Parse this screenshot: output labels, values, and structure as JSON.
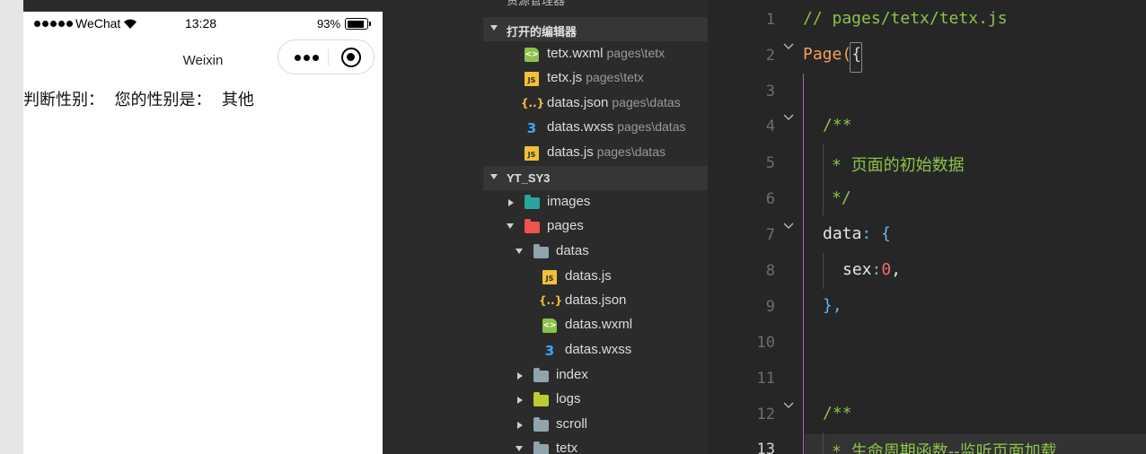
{
  "simulator": {
    "status_bar": {
      "carrier": "WeChat",
      "time": "13:28",
      "battery": "93%"
    },
    "nav_title": "Weixin",
    "page_text": "判断性别：  您的性别是：  其他"
  },
  "explorer": {
    "top_label": "资源管理器",
    "open_editors": {
      "title": "打开的编辑器",
      "items": [
        {
          "name": "tetx.wxml",
          "path": "pages\\tetx",
          "icon": "wxml-file-icon"
        },
        {
          "name": "tetx.js",
          "path": "pages\\tetx",
          "icon": "js-file-icon"
        },
        {
          "name": "datas.json",
          "path": "pages\\datas",
          "icon": "json-file-icon"
        },
        {
          "name": "datas.wxss",
          "path": "pages\\datas",
          "icon": "wxss-file-icon"
        },
        {
          "name": "datas.js",
          "path": "pages\\datas",
          "icon": "js-file-icon"
        }
      ]
    },
    "project": {
      "title": "YT_SY3",
      "tree": [
        {
          "name": "images",
          "type": "folder",
          "expanded": false,
          "color": "#26a69a"
        },
        {
          "name": "pages",
          "type": "folder",
          "expanded": true,
          "color": "#ef5350"
        },
        {
          "name": "datas",
          "type": "folder",
          "expanded": true,
          "color": "#90a4ae"
        },
        {
          "name": "datas.js",
          "type": "js"
        },
        {
          "name": "datas.json",
          "type": "json"
        },
        {
          "name": "datas.wxml",
          "type": "wxml"
        },
        {
          "name": "datas.wxss",
          "type": "wxss"
        },
        {
          "name": "index",
          "type": "folder",
          "expanded": false,
          "color": "#90a4ae"
        },
        {
          "name": "logs",
          "type": "folder",
          "expanded": false,
          "color": "#c0ca33"
        },
        {
          "name": "scroll",
          "type": "folder",
          "expanded": false,
          "color": "#90a4ae"
        },
        {
          "name": "tetx",
          "type": "folder",
          "expanded": true,
          "color": "#90a4ae"
        }
      ]
    }
  },
  "editor": {
    "line_numbers": [
      "1",
      "2",
      "3",
      "4",
      "5",
      "6",
      "7",
      "8",
      "9",
      "10",
      "11",
      "12",
      "13"
    ],
    "lines": {
      "l1": "// pages/tetx/tetx.js",
      "l2_class": "Page",
      "l2_paren": "(",
      "l2_brace": "{",
      "l4": "/**",
      "l5_star": "* ",
      "l5_text": "页面的初始数据",
      "l6": "*/",
      "l7_prop": "data",
      "l7_colon": ": ",
      "l7_brace": "{",
      "l8_prop": "sex",
      "l8_colon": ":",
      "l8_num": "0",
      "l8_comma": ",",
      "l9": "},",
      "l12": "/**",
      "l13_star": "* ",
      "l13_text": "生命周期函数--监听页面加载"
    }
  }
}
